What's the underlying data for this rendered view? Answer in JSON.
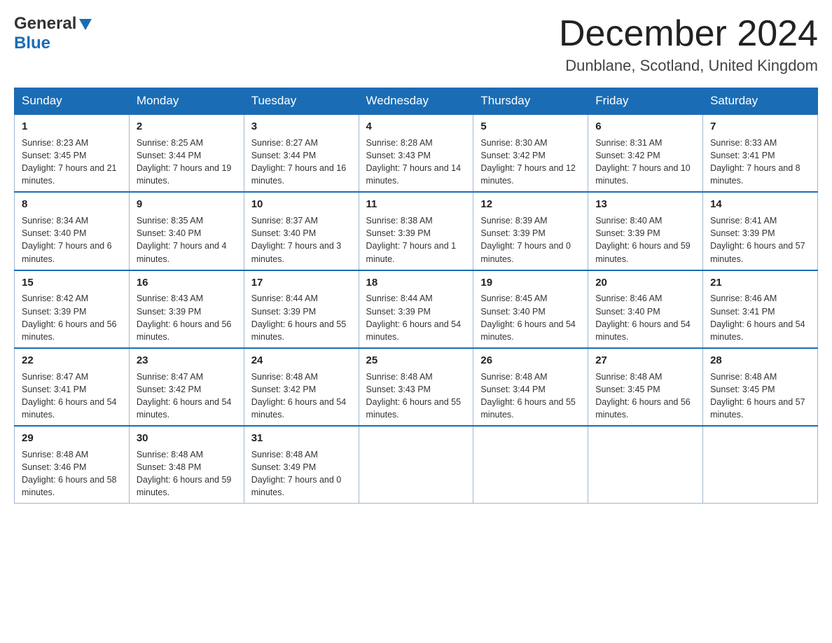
{
  "header": {
    "logo_general": "General",
    "logo_blue": "Blue",
    "month_title": "December 2024",
    "location": "Dunblane, Scotland, United Kingdom"
  },
  "days_of_week": [
    "Sunday",
    "Monday",
    "Tuesday",
    "Wednesday",
    "Thursday",
    "Friday",
    "Saturday"
  ],
  "weeks": [
    [
      {
        "day": "1",
        "sunrise": "8:23 AM",
        "sunset": "3:45 PM",
        "daylight": "7 hours and 21 minutes."
      },
      {
        "day": "2",
        "sunrise": "8:25 AM",
        "sunset": "3:44 PM",
        "daylight": "7 hours and 19 minutes."
      },
      {
        "day": "3",
        "sunrise": "8:27 AM",
        "sunset": "3:44 PM",
        "daylight": "7 hours and 16 minutes."
      },
      {
        "day": "4",
        "sunrise": "8:28 AM",
        "sunset": "3:43 PM",
        "daylight": "7 hours and 14 minutes."
      },
      {
        "day": "5",
        "sunrise": "8:30 AM",
        "sunset": "3:42 PM",
        "daylight": "7 hours and 12 minutes."
      },
      {
        "day": "6",
        "sunrise": "8:31 AM",
        "sunset": "3:42 PM",
        "daylight": "7 hours and 10 minutes."
      },
      {
        "day": "7",
        "sunrise": "8:33 AM",
        "sunset": "3:41 PM",
        "daylight": "7 hours and 8 minutes."
      }
    ],
    [
      {
        "day": "8",
        "sunrise": "8:34 AM",
        "sunset": "3:40 PM",
        "daylight": "7 hours and 6 minutes."
      },
      {
        "day": "9",
        "sunrise": "8:35 AM",
        "sunset": "3:40 PM",
        "daylight": "7 hours and 4 minutes."
      },
      {
        "day": "10",
        "sunrise": "8:37 AM",
        "sunset": "3:40 PM",
        "daylight": "7 hours and 3 minutes."
      },
      {
        "day": "11",
        "sunrise": "8:38 AM",
        "sunset": "3:39 PM",
        "daylight": "7 hours and 1 minute."
      },
      {
        "day": "12",
        "sunrise": "8:39 AM",
        "sunset": "3:39 PM",
        "daylight": "7 hours and 0 minutes."
      },
      {
        "day": "13",
        "sunrise": "8:40 AM",
        "sunset": "3:39 PM",
        "daylight": "6 hours and 59 minutes."
      },
      {
        "day": "14",
        "sunrise": "8:41 AM",
        "sunset": "3:39 PM",
        "daylight": "6 hours and 57 minutes."
      }
    ],
    [
      {
        "day": "15",
        "sunrise": "8:42 AM",
        "sunset": "3:39 PM",
        "daylight": "6 hours and 56 minutes."
      },
      {
        "day": "16",
        "sunrise": "8:43 AM",
        "sunset": "3:39 PM",
        "daylight": "6 hours and 56 minutes."
      },
      {
        "day": "17",
        "sunrise": "8:44 AM",
        "sunset": "3:39 PM",
        "daylight": "6 hours and 55 minutes."
      },
      {
        "day": "18",
        "sunrise": "8:44 AM",
        "sunset": "3:39 PM",
        "daylight": "6 hours and 54 minutes."
      },
      {
        "day": "19",
        "sunrise": "8:45 AM",
        "sunset": "3:40 PM",
        "daylight": "6 hours and 54 minutes."
      },
      {
        "day": "20",
        "sunrise": "8:46 AM",
        "sunset": "3:40 PM",
        "daylight": "6 hours and 54 minutes."
      },
      {
        "day": "21",
        "sunrise": "8:46 AM",
        "sunset": "3:41 PM",
        "daylight": "6 hours and 54 minutes."
      }
    ],
    [
      {
        "day": "22",
        "sunrise": "8:47 AM",
        "sunset": "3:41 PM",
        "daylight": "6 hours and 54 minutes."
      },
      {
        "day": "23",
        "sunrise": "8:47 AM",
        "sunset": "3:42 PM",
        "daylight": "6 hours and 54 minutes."
      },
      {
        "day": "24",
        "sunrise": "8:48 AM",
        "sunset": "3:42 PM",
        "daylight": "6 hours and 54 minutes."
      },
      {
        "day": "25",
        "sunrise": "8:48 AM",
        "sunset": "3:43 PM",
        "daylight": "6 hours and 55 minutes."
      },
      {
        "day": "26",
        "sunrise": "8:48 AM",
        "sunset": "3:44 PM",
        "daylight": "6 hours and 55 minutes."
      },
      {
        "day": "27",
        "sunrise": "8:48 AM",
        "sunset": "3:45 PM",
        "daylight": "6 hours and 56 minutes."
      },
      {
        "day": "28",
        "sunrise": "8:48 AM",
        "sunset": "3:45 PM",
        "daylight": "6 hours and 57 minutes."
      }
    ],
    [
      {
        "day": "29",
        "sunrise": "8:48 AM",
        "sunset": "3:46 PM",
        "daylight": "6 hours and 58 minutes."
      },
      {
        "day": "30",
        "sunrise": "8:48 AM",
        "sunset": "3:48 PM",
        "daylight": "6 hours and 59 minutes."
      },
      {
        "day": "31",
        "sunrise": "8:48 AM",
        "sunset": "3:49 PM",
        "daylight": "7 hours and 0 minutes."
      },
      null,
      null,
      null,
      null
    ]
  ],
  "labels": {
    "sunrise": "Sunrise:",
    "sunset": "Sunset:",
    "daylight": "Daylight:"
  }
}
